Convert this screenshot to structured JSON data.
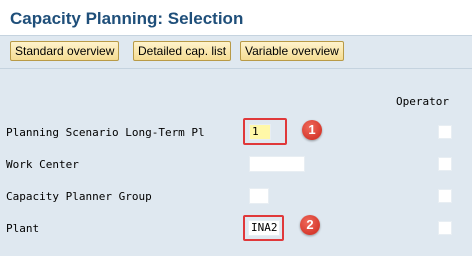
{
  "window": {
    "title": "Capacity Planning: Selection"
  },
  "toolbar": {
    "buttons": [
      {
        "label": "Standard overview"
      },
      {
        "label": "Detailed cap. list"
      },
      {
        "label": "Variable overview"
      }
    ]
  },
  "form": {
    "operator_header": "Operator",
    "rows": [
      {
        "label": "Planning Scenario Long-Term Pl",
        "value": "1"
      },
      {
        "label": "Work Center",
        "value": ""
      },
      {
        "label": "Capacity Planner Group",
        "value": ""
      },
      {
        "label": "Plant",
        "value": "INA2"
      }
    ]
  },
  "annotations": {
    "callouts": [
      "1",
      "2"
    ],
    "highlight_color": "#e0383a"
  },
  "colors": {
    "title": "#1f4f7a",
    "background": "#dfe8f0",
    "button_fill": "#f5dc92",
    "filled_field": "#fff8a8"
  }
}
